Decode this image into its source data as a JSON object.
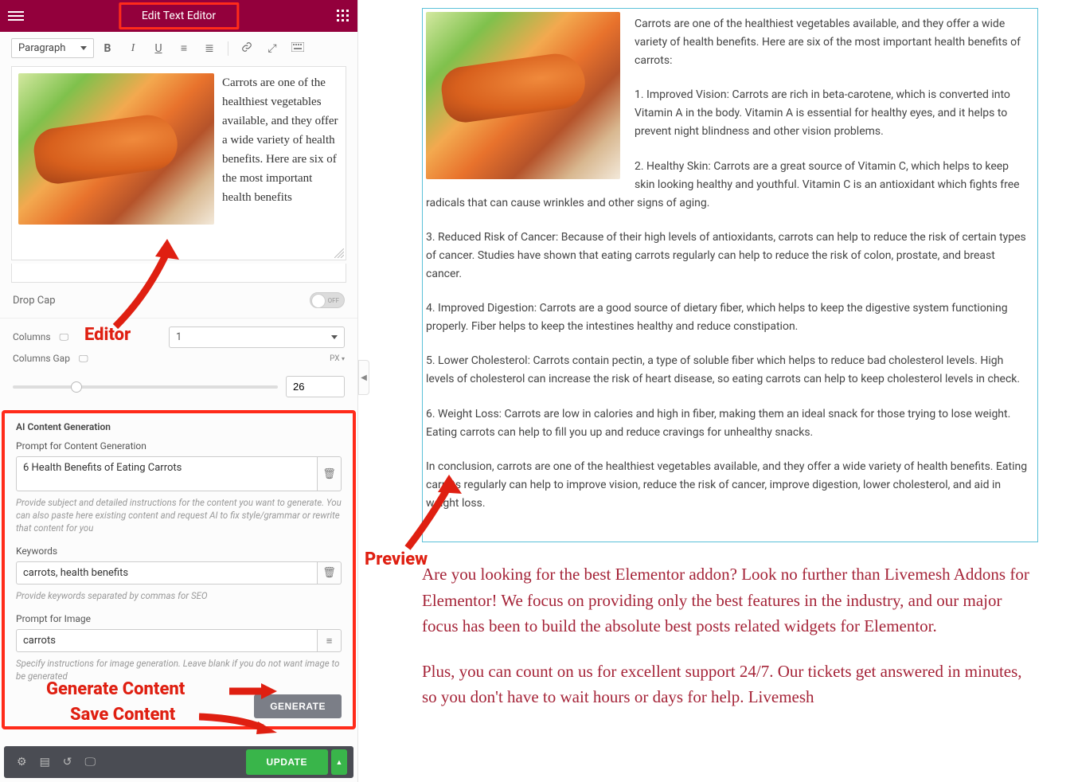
{
  "header": {
    "title": "Edit Text Editor"
  },
  "toolbar": {
    "format": "Paragraph",
    "bold": "B",
    "italic": "I",
    "underline": "U",
    "ol": "≡",
    "ul": "≣",
    "link": "🔗",
    "expand": "⤢",
    "more": "⌨"
  },
  "editor": {
    "intro": "Carrots are one of the healthiest vegetables available, and they offer a wide variety of health benefits. Here are six of the most important health benefits"
  },
  "settings": {
    "dropcap_label": "Drop Cap",
    "dropcap_off": "OFF",
    "columns_label": "Columns",
    "columns_value": "1",
    "columns_gap_label": "Columns Gap",
    "unit": "PX",
    "gap_value": "26"
  },
  "ai": {
    "section_title": "AI Content Generation",
    "prompt_label": "Prompt for Content Generation",
    "prompt_value": "6 Health Benefits of Eating Carrots",
    "prompt_help": "Provide subject and detailed instructions for the content you want to generate. You can also paste here existing content and request AI to fix style/grammar or rewrite that content for you",
    "keywords_label": "Keywords",
    "keywords_value": "carrots, health benefits",
    "keywords_help": "Provide keywords separated by commas for SEO",
    "image_label": "Prompt for Image",
    "image_value": "carrots",
    "image_help": "Specify instructions for image generation. Leave blank if you do not want image to be generated",
    "generate_label": "GENERATE"
  },
  "bottom": {
    "update_label": "UPDATE"
  },
  "preview": {
    "intro": "Carrots are one of the healthiest vegetables available, and they offer a wide variety of health benefits. Here are six of the most important health benefits of carrots:",
    "p1": "1. Improved Vision: Carrots are rich in beta-carotene, which is converted into Vitamin A in the body. Vitamin A is essential for healthy eyes, and it helps to prevent night blindness and other vision problems.",
    "p2": "2. Healthy Skin: Carrots are a great source of Vitamin C, which helps to keep skin looking healthy and youthful. Vitamin C is an antioxidant which fights free radicals that can cause wrinkles and other signs of aging.",
    "p3": "3. Reduced Risk of Cancer: Because of their high levels of antioxidants, carrots can help to reduce the risk of certain types of cancer. Studies have shown that eating carrots regularly can help to reduce the risk of colon, prostate, and breast cancer.",
    "p4": "4. Improved Digestion: Carrots are a good source of dietary fiber, which helps to keep the digestive system functioning properly. Fiber helps to keep the intestines healthy and reduce constipation.",
    "p5": "5. Lower Cholesterol: Carrots contain pectin, a type of soluble fiber which helps to reduce bad cholesterol levels. High levels of cholesterol can increase the risk of heart disease, so eating carrots can help to keep cholesterol levels in check.",
    "p6": "6. Weight Loss: Carrots are low in calories and high in fiber, making them an ideal snack for those trying to lose weight. Eating carrots can help to fill you up and reduce cravings for unhealthy snacks.",
    "conclusion": "In conclusion, carrots are one of the healthiest vegetables available, and they offer a wide variety of health benefits. Eating carrots regularly can help to improve vision, reduce the risk of cancer, improve digestion, lower cholesterol, and aid in weight loss.",
    "promo1": "Are you looking for the best Elementor addon? Look no further than Livemesh Addons for Elementor! We focus on providing only the best features in the industry, and our major focus has been to build the absolute best posts related widgets for Elementor.",
    "promo2": "Plus, you can count on us for excellent support 24/7. Our tickets get answered in minutes, so you don't have to wait hours or days for help. Livemesh"
  },
  "annotations": {
    "editor": "Editor",
    "preview": "Preview",
    "generate": "Generate Content",
    "save": "Save Content"
  }
}
